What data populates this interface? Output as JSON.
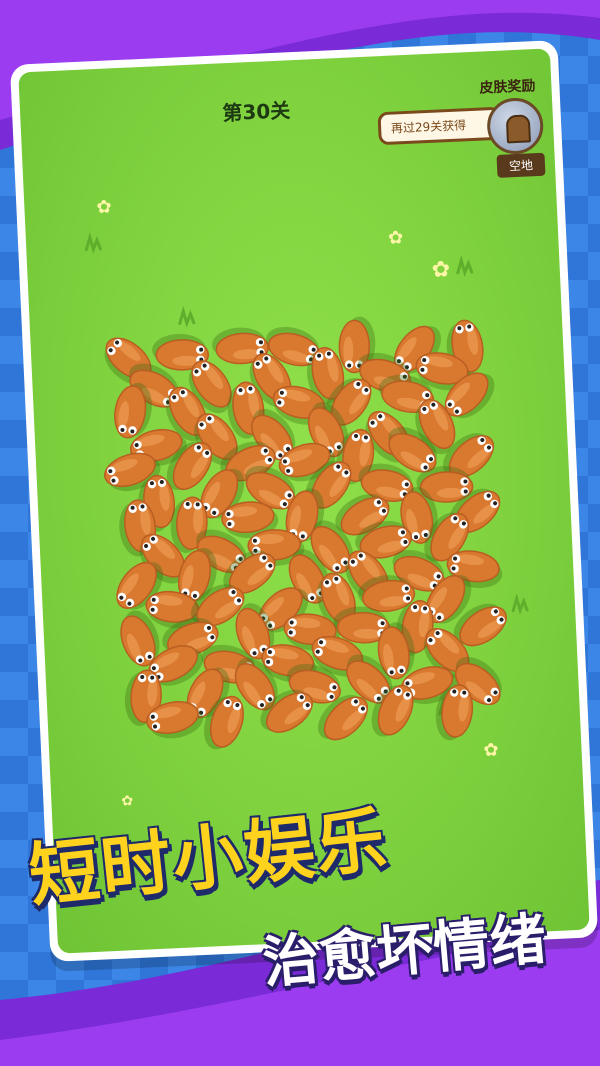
{
  "level": {
    "label": "第30关"
  },
  "reward": {
    "title": "皮肤奖励",
    "hint": "再过29关获得",
    "item_name": "空地",
    "thumb_icon": "door-icon"
  },
  "banner": {
    "line1": "短时小娱乐",
    "line2": "治愈坏情绪"
  },
  "colors": {
    "grass": "#7fd23e",
    "creature": "#d9782f",
    "banner_yellow": "#ffd21e",
    "swoosh": "#8a2fe0"
  },
  "game": {
    "creature_icon": "bean-creature-icon"
  }
}
